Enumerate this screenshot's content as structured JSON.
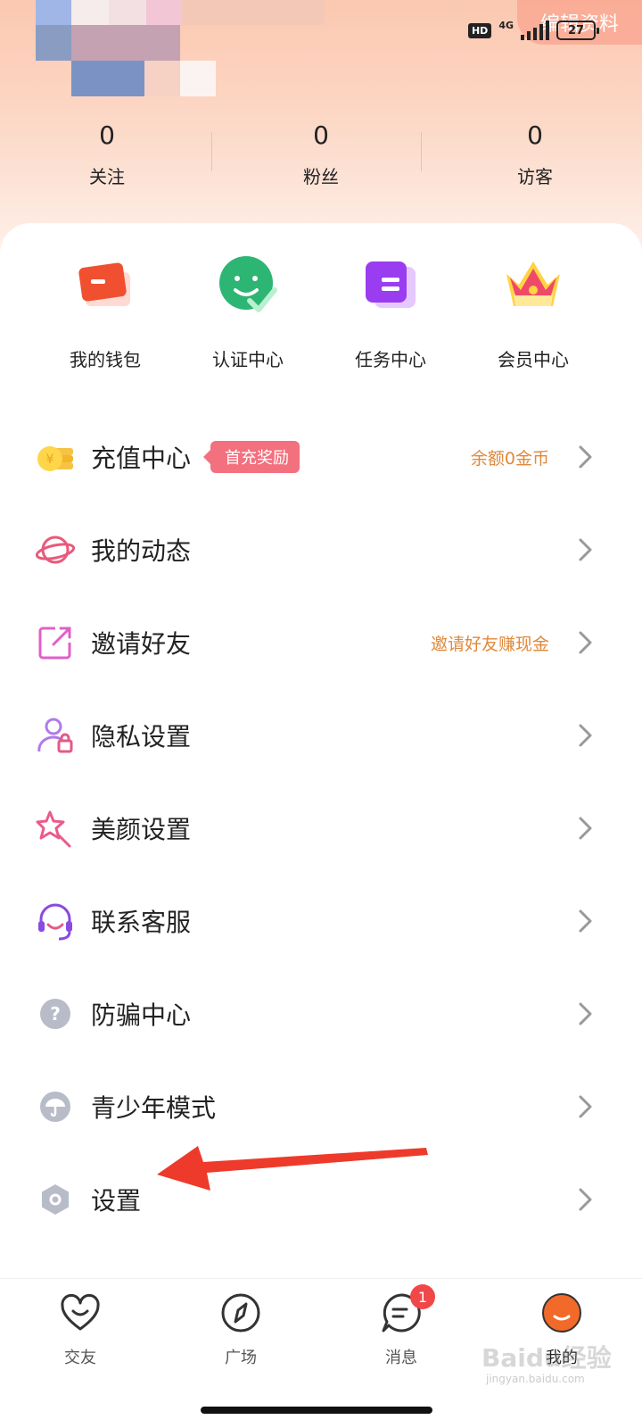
{
  "header": {
    "edit_profile": "编辑资料",
    "status": {
      "hd": "HD",
      "network": "4G",
      "battery": "27"
    }
  },
  "stats": [
    {
      "value": "0",
      "label": "关注"
    },
    {
      "value": "0",
      "label": "粉丝"
    },
    {
      "value": "0",
      "label": "访客"
    }
  ],
  "quick_actions": [
    {
      "label": "我的钱包",
      "icon": "wallet-icon"
    },
    {
      "label": "认证中心",
      "icon": "verify-icon"
    },
    {
      "label": "任务中心",
      "icon": "task-icon"
    },
    {
      "label": "会员中心",
      "icon": "crown-icon"
    }
  ],
  "menu": [
    {
      "label": "充值中心",
      "badge": "首充奖励",
      "extra": "余额0金币",
      "icon": "coin-icon"
    },
    {
      "label": "我的动态",
      "icon": "planet-icon"
    },
    {
      "label": "邀请好友",
      "extra": "邀请好友赚现金",
      "icon": "share-icon"
    },
    {
      "label": "隐私设置",
      "icon": "privacy-icon"
    },
    {
      "label": "美颜设置",
      "icon": "star-wand-icon"
    },
    {
      "label": "联系客服",
      "icon": "headset-icon"
    },
    {
      "label": "防骗中心",
      "icon": "question-icon"
    },
    {
      "label": "青少年模式",
      "icon": "umbrella-icon"
    },
    {
      "label": "设置",
      "icon": "settings-icon"
    }
  ],
  "tabs": [
    {
      "label": "交友",
      "icon": "heart-chat-icon"
    },
    {
      "label": "广场",
      "icon": "compass-icon"
    },
    {
      "label": "消息",
      "icon": "message-icon",
      "badge": "1"
    },
    {
      "label": "我的",
      "icon": "avatar-icon"
    }
  ],
  "watermark": {
    "main": "Baidu经验",
    "sub": "jingyan.baidu.com"
  },
  "colors": {
    "accent_orange": "#e0893a",
    "badge_pink": "#f3707f",
    "arrow_red": "#ee3a2a"
  }
}
